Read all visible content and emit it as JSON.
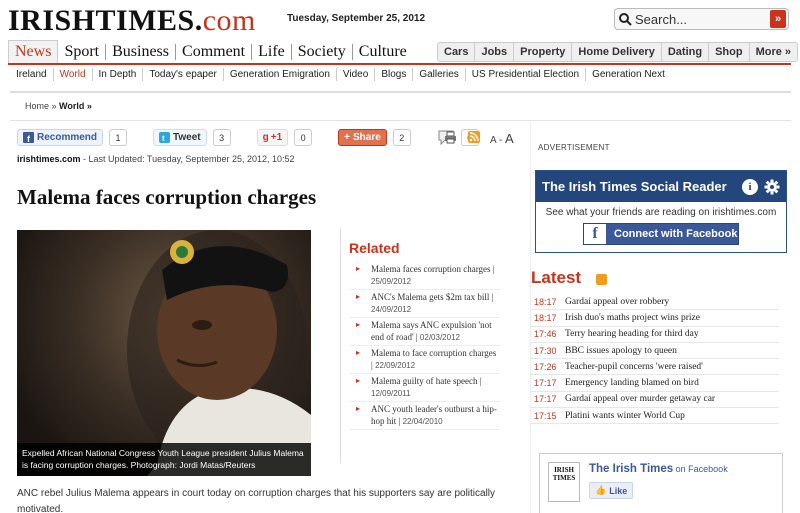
{
  "header": {
    "logo_main": "IRISHTIMES.",
    "logo_com": "com",
    "date": "Tuesday, September 25, 2012",
    "search_placeholder": "Search...",
    "search_go": "»"
  },
  "main_nav": [
    "News",
    "Sport",
    "Business",
    "Comment",
    "Life",
    "Society",
    "Culture"
  ],
  "right_nav": [
    "Cars",
    "Jobs",
    "Property",
    "Home Delivery",
    "Dating",
    "Shop",
    "More »"
  ],
  "sub_nav": [
    "Ireland",
    "World",
    "In Depth",
    "Today's epaper",
    "Generation Emigration",
    "Video",
    "Blogs",
    "Galleries",
    "US Presidential Election",
    "Generation Next"
  ],
  "breadcrumb": {
    "home": "Home »",
    "section": "World »"
  },
  "share": {
    "recommend": "Recommend",
    "recommend_count": "1",
    "tweet": "Tweet",
    "tweet_count": "3",
    "gplus": "+1",
    "gplus_count": "0",
    "share": "Share",
    "share_count": "2",
    "comments_count": "0",
    "text_small": "A -",
    "text_big": "A"
  },
  "byline": {
    "source": "irishtimes.com",
    "updated": " - Last Updated: Tuesday, September 25, 2012, 10:52"
  },
  "article": {
    "headline": "Malema faces corruption charges",
    "caption": "Expelled African National Congress Youth League president Julius Malema is facing corruption charges. Photograph: Jordi Matas/Reuters",
    "lead": "ANC rebel Julius Malema appears in court today on corruption charges that his supporters say are politically motivated."
  },
  "related": {
    "title": "Related",
    "items": [
      {
        "title": "Malema faces corruption charges",
        "date": "25/09/2012"
      },
      {
        "title": "ANC's Malema gets $2m tax bill",
        "date": "24/09/2012"
      },
      {
        "title": "Malema says ANC expulsion 'not end of road'",
        "date": "02/03/2012"
      },
      {
        "title": "Malema to face corruption charges",
        "date": "22/09/2012"
      },
      {
        "title": "Malema guilty of hate speech",
        "date": "12/09/2011"
      },
      {
        "title": "ANC youth leader's outburst a hip-hop hit",
        "date": "22/04/2010"
      }
    ]
  },
  "sidebar": {
    "ad_label": "ADVERTISEMENT",
    "social_title": "The Irish Times Social Reader",
    "social_sub": "See what your friends are reading on irishtimes.com",
    "connect": "Connect with Facebook",
    "latest_title": "Latest",
    "latest": [
      {
        "time": "18:17",
        "headline": "Gardaí appeal over robbery"
      },
      {
        "time": "18:17",
        "headline": "Irish duo's maths project wins prize"
      },
      {
        "time": "17:46",
        "headline": "Terry hearing heading for third day"
      },
      {
        "time": "17:30",
        "headline": "BBC issues apology to queen"
      },
      {
        "time": "17:26",
        "headline": "Teacher-pupil concerns 'were raised'"
      },
      {
        "time": "17:17",
        "headline": "Emergency landing blamed on bird"
      },
      {
        "time": "17:17",
        "headline": "Gardaí appeal over murder getaway car"
      },
      {
        "time": "17:15",
        "headline": "Platini wants winter World Cup"
      }
    ],
    "fb_name": "The Irish Times",
    "fb_on": " on Facebook",
    "fb_like": "Like",
    "fb_logo": "IRISH TIMES"
  }
}
